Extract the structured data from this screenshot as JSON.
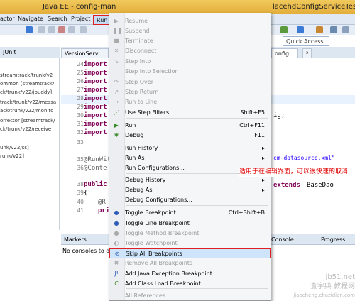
{
  "window": {
    "title_left": "Java EE - config-man",
    "title_right": "lacehdConfigServiceTestV"
  },
  "menubar": {
    "items": [
      "actor",
      "Navigate",
      "Search",
      "Project",
      "Run"
    ]
  },
  "toolbar": {
    "quick_access": "Quick Access"
  },
  "left_pane": {
    "tab": "JUnit",
    "items": [
      "streamtrack/trunk/v2",
      "ommon [streamtrack/",
      "ck/trunk/v22/jbuddy]",
      "track/trunk/v22/messa",
      "ack/trunk/v22/monito",
      "orrector [streamtrack/",
      "ck/trunk/v22/receive",
      "unk/v22/ss]",
      "runk/v22]"
    ]
  },
  "editor": {
    "tabs": [
      "VersionServi...",
      "onfig...",
      "²"
    ],
    "lines": [
      {
        "n": "24",
        "kw": "import",
        "rest": ""
      },
      {
        "n": "25",
        "kw": "import",
        "rest": ""
      },
      {
        "n": "26",
        "kw": "import",
        "rest": ""
      },
      {
        "n": "27",
        "kw": "import",
        "rest": ""
      },
      {
        "n": "28",
        "kw": "import",
        "rest": ""
      },
      {
        "n": "29",
        "kw": "import",
        "rest": ""
      },
      {
        "n": "30",
        "kw": "import",
        "rest": ""
      },
      {
        "n": "31",
        "kw": "import",
        "rest": ""
      },
      {
        "n": "32",
        "kw": "import",
        "rest": ""
      },
      {
        "n": "33",
        "kw": "",
        "rest": ""
      },
      {
        "n": "35",
        "kw": "",
        "rest": "@RunWit"
      },
      {
        "n": "36",
        "kw": "",
        "rest": "@Conte"
      },
      {
        "n": "38",
        "kw": "public",
        "rest": ""
      },
      {
        "n": "39",
        "kw": "",
        "rest": "{"
      },
      {
        "n": "40",
        "kw": "",
        "rest": "@R"
      },
      {
        "n": "41",
        "kw": "",
        "rest": "pri"
      }
    ],
    "right_fragments": {
      "ig": "ig;",
      "xml": "cm-datasource.xml\"",
      "extends": "extends",
      "basedao": "BaseDao"
    }
  },
  "bottom_panel": {
    "tabs": {
      "markers": "Markers",
      "console": "Console",
      "progress": "Progress"
    },
    "message": "No consoles to di"
  },
  "run_menu": {
    "items": [
      {
        "label": "Resume",
        "shortcut": "",
        "disabled": true,
        "icon": "resume-icon",
        "glyph": "▶"
      },
      {
        "label": "Suspend",
        "shortcut": "",
        "disabled": true,
        "icon": "suspend-icon",
        "glyph": "❚❚"
      },
      {
        "label": "Terminate",
        "shortcut": "",
        "disabled": true,
        "icon": "terminate-icon",
        "glyph": "■"
      },
      {
        "label": "Disconnect",
        "shortcut": "",
        "disabled": true,
        "icon": "disconnect-icon",
        "glyph": "✕"
      },
      {
        "label": "Step Into",
        "shortcut": "",
        "disabled": true,
        "icon": "step-into-icon",
        "glyph": "↘"
      },
      {
        "label": "Step Into Selection",
        "shortcut": "",
        "disabled": true,
        "icon": "",
        "glyph": ""
      },
      {
        "label": "Step Over",
        "shortcut": "",
        "disabled": true,
        "icon": "step-over-icon",
        "glyph": "↷"
      },
      {
        "label": "Step Return",
        "shortcut": "",
        "disabled": true,
        "icon": "step-return-icon",
        "glyph": "↗"
      },
      {
        "label": "Run to Line",
        "shortcut": "",
        "disabled": true,
        "icon": "run-to-line-icon",
        "glyph": "→"
      },
      {
        "label": "Use Step Filters",
        "shortcut": "Shift+F5",
        "disabled": false,
        "icon": "step-filters-icon",
        "glyph": "⋰"
      },
      {
        "label": "Run",
        "shortcut": "Ctrl+F11",
        "disabled": false,
        "icon": "run-icon",
        "glyph": "▶"
      },
      {
        "label": "Debug",
        "shortcut": "F11",
        "disabled": false,
        "icon": "debug-icon",
        "glyph": "✱"
      },
      {
        "label": "Run History",
        "shortcut": "▸",
        "disabled": false,
        "icon": "",
        "glyph": ""
      },
      {
        "label": "Run As",
        "shortcut": "▸",
        "disabled": false,
        "icon": "",
        "glyph": ""
      },
      {
        "label": "Run Configurations...",
        "shortcut": "",
        "disabled": false,
        "icon": "",
        "glyph": ""
      },
      {
        "label": "Debug History",
        "shortcut": "▸",
        "disabled": false,
        "icon": "",
        "glyph": ""
      },
      {
        "label": "Debug As",
        "shortcut": "▸",
        "disabled": false,
        "icon": "",
        "glyph": ""
      },
      {
        "label": "Debug Configurations...",
        "shortcut": "",
        "disabled": false,
        "icon": "",
        "glyph": ""
      },
      {
        "label": "Toggle Breakpoint",
        "shortcut": "Ctrl+Shift+B",
        "disabled": false,
        "icon": "breakpoint-icon",
        "glyph": "●"
      },
      {
        "label": "Toggle Line Breakpoint",
        "shortcut": "",
        "disabled": false,
        "icon": "line-breakpoint-icon",
        "glyph": "●"
      },
      {
        "label": "Toggle Method Breakpoint",
        "shortcut": "",
        "disabled": true,
        "icon": "method-breakpoint-icon",
        "glyph": "●"
      },
      {
        "label": "Toggle Watchpoint",
        "shortcut": "",
        "disabled": true,
        "icon": "watchpoint-icon",
        "glyph": "◐"
      },
      {
        "label": "Skip All Breakpoints",
        "shortcut": "",
        "disabled": false,
        "icon": "skip-breakpoints-icon",
        "glyph": "⊘"
      },
      {
        "label": "Remove All Breakpoints",
        "shortcut": "",
        "disabled": true,
        "icon": "remove-breakpoints-icon",
        "glyph": "✖"
      },
      {
        "label": "Add Java Exception Breakpoint...",
        "shortcut": "",
        "disabled": false,
        "icon": "exception-breakpoint-icon",
        "glyph": "J!"
      },
      {
        "label": "Add Class Load Breakpoint...",
        "shortcut": "",
        "disabled": false,
        "icon": "class-load-icon",
        "glyph": "C"
      },
      {
        "label": "All References...",
        "shortcut": "",
        "disabled": true,
        "icon": "",
        "glyph": ""
      }
    ]
  },
  "annotation": {
    "text": "适用于在编辑界面，可以很快速的取消"
  },
  "watermark": {
    "site": "jb51.net",
    "name": "查字典 教程网",
    "url": "jiaocheng.chazidian.com"
  },
  "colors": {
    "highlight_border": "#e02020",
    "selected_bg": "#cde4fb",
    "annotation": "#e00000"
  }
}
